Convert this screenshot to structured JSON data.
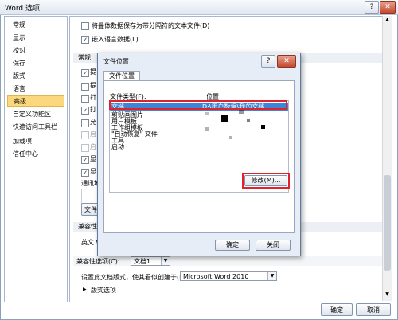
{
  "window": {
    "title": "Word 选项",
    "help": "?",
    "close": "✕"
  },
  "sidebar": {
    "items": [
      {
        "label": "常规"
      },
      {
        "label": "显示"
      },
      {
        "label": "校对"
      },
      {
        "label": "保存"
      },
      {
        "label": "版式"
      },
      {
        "label": "语言"
      },
      {
        "label": "高级",
        "active": true
      },
      {
        "label": "自定义功能区"
      },
      {
        "label": "快速访问工具栏"
      },
      {
        "label": "加载项"
      },
      {
        "label": "信任中心"
      }
    ]
  },
  "main": {
    "top_options": [
      {
        "label": "将叠体数据保存为带分隔符的文本文件(D)",
        "checked": false
      },
      {
        "label": "嵌入语言数据(L)",
        "checked": true
      }
    ],
    "general_section": "常规",
    "partial_rows": [
      {
        "label": "提",
        "checked": true
      },
      {
        "label": "提",
        "checked": false
      },
      {
        "label": "打",
        "checked": false
      },
      {
        "label": "打",
        "checked": true
      },
      {
        "label": "允",
        "checked": false
      },
      {
        "label": "启",
        "checked": false
      },
      {
        "label": "启",
        "checked": false
      },
      {
        "label": "显",
        "checked": true
      },
      {
        "label": "显",
        "checked": true
      }
    ],
    "mailing_label": "通讯地",
    "file_locations_button": "文件位",
    "compat_section": "兼容性",
    "compat_lang": "英文 W",
    "compat_options_label": "兼容性选项(C):",
    "compat_doc_value": "文档1",
    "layout_label": "设置此文档版式，使其看似创建于(L):",
    "layout_value": "Microsoft Word 2010",
    "layout_options_label": "版式选项"
  },
  "footer": {
    "ok": "确定",
    "cancel": "取消"
  },
  "dialog": {
    "title": "文件位置",
    "help": "?",
    "close": "✕",
    "tab": "文件位置",
    "col_type": "文件类型(F):",
    "col_location": "位置:",
    "rows": [
      {
        "type": "文档",
        "location": "D:\\用户数据\\我的文档",
        "selected": true
      },
      {
        "type": "剪贴画图片",
        "location": ""
      },
      {
        "type": "用户模板",
        "location": ""
      },
      {
        "type": "工作组模板",
        "location": ""
      },
      {
        "type": "\"自动恢复\" 文件",
        "location": ""
      },
      {
        "type": "工具",
        "location": ""
      },
      {
        "type": "启动",
        "location": ""
      }
    ],
    "modify_button": "修改(M)...",
    "ok_button": "确定",
    "close_button": "关闭"
  }
}
